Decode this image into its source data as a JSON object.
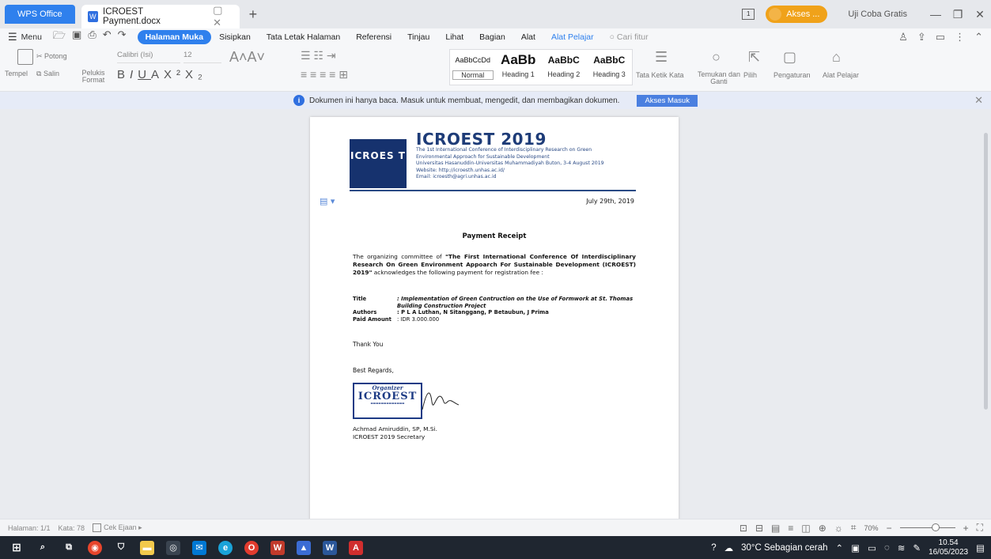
{
  "titlebar": {
    "app_tab": "WPS Office",
    "doc_tab": "ICROEST Payment.docx",
    "akses": "Akses ...",
    "trial": "Uji Coba Gratis"
  },
  "menu": {
    "menu_label": "Menu",
    "tabs": [
      "Halaman Muka",
      "Sisipkan",
      "Tata Letak Halaman",
      "Referensi",
      "Tinjau",
      "Lihat",
      "Bagian",
      "Alat",
      "Alat Pelajar"
    ],
    "search": "Cari fitur"
  },
  "ribbon": {
    "paste": "Tempel",
    "cut": "Potong",
    "copy": "Salin",
    "format_painter": "Pelukis Format",
    "font": "Calibri (Isi)",
    "size": "12",
    "styles": [
      {
        "sample": "AaBbCcDd",
        "label": "Normal"
      },
      {
        "sample": "AaBb",
        "label": "Heading 1"
      },
      {
        "sample": "AaBbC",
        "label": "Heading 2"
      },
      {
        "sample": "AaBbC",
        "label": "Heading 3"
      }
    ],
    "text_layout": "Tata Ketik Kata",
    "find_replace": "Temukan dan Ganti",
    "select": "Pilih",
    "settings": "Pengaturan",
    "study_tools": "Alat Pelajar"
  },
  "notice": {
    "message": "Dokumen ini hanya baca. Masuk untuk membuat, mengedit, dan membagikan dokumen.",
    "login": "Akses Masuk"
  },
  "document": {
    "logo_text": "ICROES T",
    "title": "ICROEST 2019",
    "conf_line1": "The 1st International Conference of Interdisciplinary Research on Green",
    "conf_line2": "Environmental Approach for Sustainable Development",
    "conf_line3": "Universitas Hasanuddin-Universitas Muhammadiyah Buton, 3-4 August 2019",
    "conf_line4": "Website: http://icroesth.unhas.ac.id/",
    "conf_line5": "Email: icroesth@agri.unhas.ac.id",
    "date": "July 29th, 2019",
    "receipt_title": "Payment Receipt",
    "intro_start": "The organizing committee of ",
    "intro_bold": "\"The First International Conference Of Interdisciplinary Research On Green Environment Appoarch For Sustainable Development (ICROEST) 2019\"",
    "intro_end": " acknowledges the following payment for registration fee :",
    "title_label": "Title",
    "title_value": ": Implementation of Green Contruction on the Use of Formwork at St. Thomas",
    "title_value2": "Building Construction Project",
    "authors_label": "Authors",
    "authors_value": ": P L A Luthan, N Sitanggang, P Betaubun, J Prima",
    "amount_label": "Paid Amount",
    "amount_value": ": IDR 3.000.000",
    "thanks": "Thank You",
    "regards": "Best Regards,",
    "stamp_org": "Organizer",
    "stamp_name": "ICROEST",
    "signer_name": "Achmad Amiruddin, SP, M.Si.",
    "signer_role": "ICROEST 2019 Secretary"
  },
  "status": {
    "page": "Halaman: 1/1",
    "words": "Kata: 78",
    "spell": "Cek Ejaan",
    "zoom": "70%"
  },
  "taskbar": {
    "weather": "30°C Sebagian cerah",
    "time": "10.54",
    "date": "16/05/2023"
  }
}
